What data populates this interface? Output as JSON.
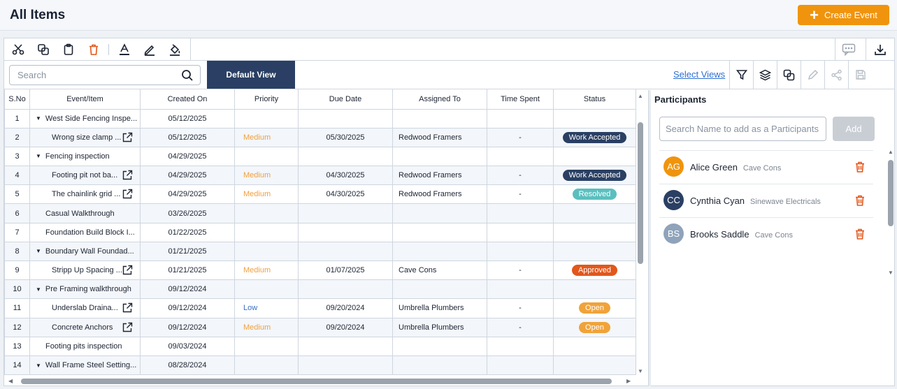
{
  "header": {
    "title": "All Items",
    "create_button": "Create Event",
    "create_button_color": "#f0940d"
  },
  "toolbar": {
    "icons": [
      "scissors-icon",
      "copy-icon",
      "clipboard-icon",
      "trash-icon",
      "font-color-icon",
      "pen-icon",
      "fill-color-icon",
      "comment-icon",
      "download-icon"
    ]
  },
  "viewbar": {
    "search_placeholder": "Search",
    "default_view": "Default View",
    "select_views": "Select Views"
  },
  "table": {
    "columns": [
      "S.No",
      "Event/Item",
      "Created On",
      "Priority",
      "Due Date",
      "Assigned To",
      "Time Spent",
      "Status"
    ],
    "rows": [
      {
        "sno": "1",
        "item": "West Side Fencing Inspe...",
        "level": "parent",
        "created": "05/12/2025",
        "priority": "",
        "due": "",
        "assigned": "",
        "time": "",
        "status": ""
      },
      {
        "sno": "2",
        "item": "Wrong size clamp ...",
        "level": "child",
        "created": "05/12/2025",
        "priority": "Medium",
        "due": "05/30/2025",
        "assigned": "Redwood Framers",
        "time": "-",
        "status": "Work Accepted"
      },
      {
        "sno": "3",
        "item": "Fencing inspection",
        "level": "parent",
        "created": "04/29/2025",
        "priority": "",
        "due": "",
        "assigned": "",
        "time": "",
        "status": ""
      },
      {
        "sno": "4",
        "item": "Footing pit not ba...",
        "level": "child",
        "created": "04/29/2025",
        "priority": "Medium",
        "due": "04/30/2025",
        "assigned": "Redwood Framers",
        "time": "-",
        "status": "Work Accepted"
      },
      {
        "sno": "5",
        "item": "The chainlink grid ...",
        "level": "child",
        "created": "04/29/2025",
        "priority": "Medium",
        "due": "04/30/2025",
        "assigned": "Redwood Framers",
        "time": "-",
        "status": "Resolved"
      },
      {
        "sno": "6",
        "item": "Casual Walkthrough",
        "level": "plain",
        "created": "03/26/2025",
        "priority": "",
        "due": "",
        "assigned": "",
        "time": "",
        "status": ""
      },
      {
        "sno": "7",
        "item": "Foundation Build Block I...",
        "level": "plain",
        "created": "01/22/2025",
        "priority": "",
        "due": "",
        "assigned": "",
        "time": "",
        "status": ""
      },
      {
        "sno": "8",
        "item": "Boundary Wall Foundad...",
        "level": "parent",
        "created": "01/21/2025",
        "priority": "",
        "due": "",
        "assigned": "",
        "time": "",
        "status": ""
      },
      {
        "sno": "9",
        "item": "Stripp Up Spacing ...",
        "level": "child",
        "created": "01/21/2025",
        "priority": "Medium",
        "due": "01/07/2025",
        "assigned": "Cave Cons",
        "time": "-",
        "status": "Approved"
      },
      {
        "sno": "10",
        "item": "Pre Framing walkthrough",
        "level": "parent",
        "created": "09/12/2024",
        "priority": "",
        "due": "",
        "assigned": "",
        "time": "",
        "status": ""
      },
      {
        "sno": "11",
        "item": "Underslab Draina...",
        "level": "child",
        "created": "09/12/2024",
        "priority": "Low",
        "due": "09/20/2024",
        "assigned": "Umbrella Plumbers",
        "time": "-",
        "status": "Open"
      },
      {
        "sno": "12",
        "item": "Concrete Anchors",
        "level": "child",
        "created": "09/12/2024",
        "priority": "Medium",
        "due": "09/20/2024",
        "assigned": "Umbrella Plumbers",
        "time": "-",
        "status": "Open"
      },
      {
        "sno": "13",
        "item": "Footing pits inspection",
        "level": "plain",
        "created": "09/03/2024",
        "priority": "",
        "due": "",
        "assigned": "",
        "time": "",
        "status": ""
      },
      {
        "sno": "14",
        "item": "Wall Frame Steel Setting...",
        "level": "parent",
        "created": "08/28/2024",
        "priority": "",
        "due": "",
        "assigned": "",
        "time": "",
        "status": ""
      }
    ],
    "status_colors": {
      "Work Accepted": "#2a3f63",
      "Resolved": "#5bbfbf",
      "Approved": "#e2571b",
      "Open": "#f0a33a"
    }
  },
  "participants": {
    "title": "Participants",
    "search_placeholder": "Search Name to add as a Participants",
    "add_button": "Add",
    "list": [
      {
        "initials": "AG",
        "name": "Alice Green",
        "company": "Cave Cons",
        "color": "#f0940d"
      },
      {
        "initials": "CC",
        "name": "Cynthia Cyan",
        "company": "Sinewave Electricals",
        "color": "#2a3f63"
      },
      {
        "initials": "BS",
        "name": "Brooks Saddle",
        "company": "Cave Cons",
        "color": "#8fa3ba"
      }
    ]
  }
}
